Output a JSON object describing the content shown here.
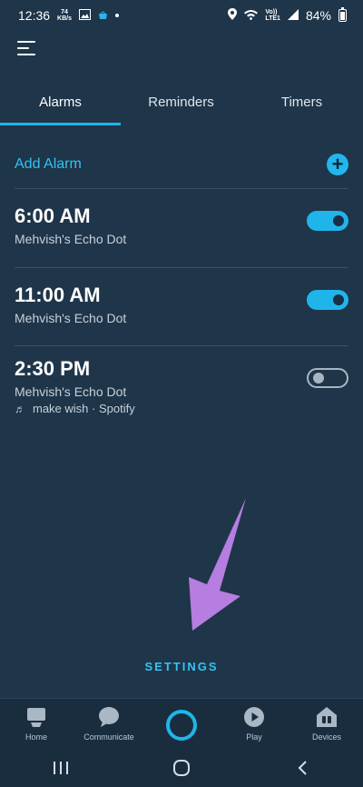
{
  "status_bar": {
    "time": "12:36",
    "kbs_value": "74",
    "kbs_unit": "KB/s",
    "network": "Vo))\nLTE1",
    "battery": "84%"
  },
  "tabs": [
    {
      "label": "Alarms",
      "active": true
    },
    {
      "label": "Reminders",
      "active": false
    },
    {
      "label": "Timers",
      "active": false
    }
  ],
  "add_alarm": {
    "label": "Add Alarm"
  },
  "alarms": [
    {
      "time": "6:00 AM",
      "device": "Mehvish's Echo Dot",
      "enabled": true
    },
    {
      "time": "11:00 AM",
      "device": "Mehvish's Echo Dot",
      "enabled": true
    },
    {
      "time": "2:30 PM",
      "device": "Mehvish's Echo Dot",
      "music": "make wish · Spotify",
      "enabled": false
    }
  ],
  "settings_label": "SETTINGS",
  "bottom_nav": {
    "home": "Home",
    "communicate": "Communicate",
    "play": "Play",
    "devices": "Devices"
  },
  "colors": {
    "background": "#1f3549",
    "accent": "#1fb5e8",
    "annotation_arrow": "#b57ee0"
  },
  "icons": {
    "menu": "hamburger-menu-icon",
    "add": "plus-circle-icon",
    "home": "echo-device-icon",
    "communicate": "chat-bubble-icon",
    "alexa": "alexa-ring-icon",
    "play": "play-circle-icon",
    "devices": "house-devices-icon"
  }
}
